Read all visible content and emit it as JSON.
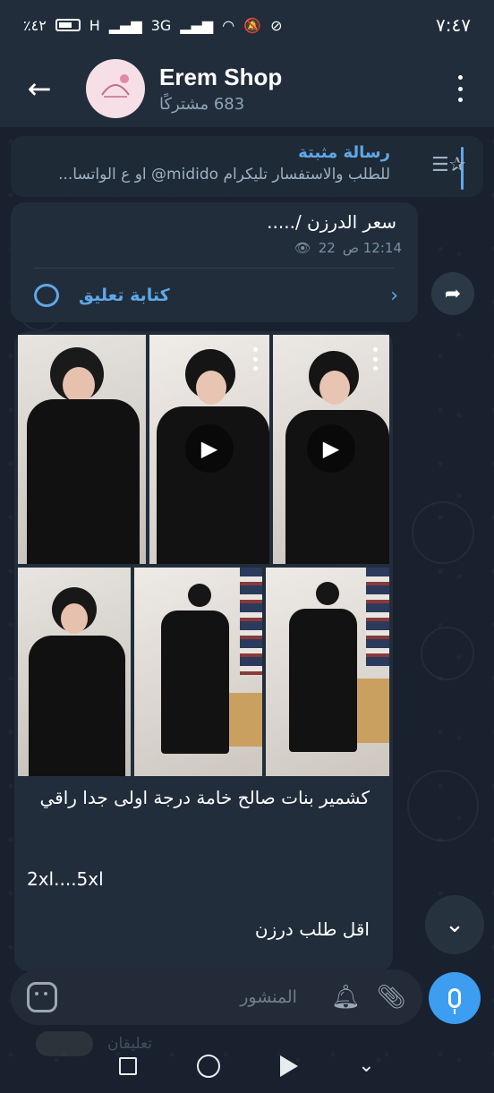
{
  "status_bar": {
    "time": "٧:٤٧",
    "battery": "٪٤٢",
    "signal_1": "H",
    "signal_2": "3G"
  },
  "header": {
    "channel_name": "Erem Shop",
    "subscribers": "683 مشتركًا"
  },
  "pinned": {
    "title": "رسالة مثبتة",
    "text": "للطلب والاستفسار تليكرام midido@ او ع الواتسا..."
  },
  "message_1": {
    "text": "سعر الدرزن /.....",
    "views": "22",
    "time": "12:14 ص",
    "comment_label": "كتابة تعليق"
  },
  "message_2": {
    "caption": "كشمير بنات صالح خامة درجة اولى جدا راقي",
    "sizes": "2xl....5xl",
    "min_order": "اقل طلب درزن"
  },
  "composer": {
    "placeholder": "المنشور"
  },
  "faded": {
    "label": "تعليقان"
  },
  "colors": {
    "accent": "#5fa8e8",
    "mic": "#3d9df0",
    "background": "#18212d",
    "bubble": "#212d3b"
  }
}
